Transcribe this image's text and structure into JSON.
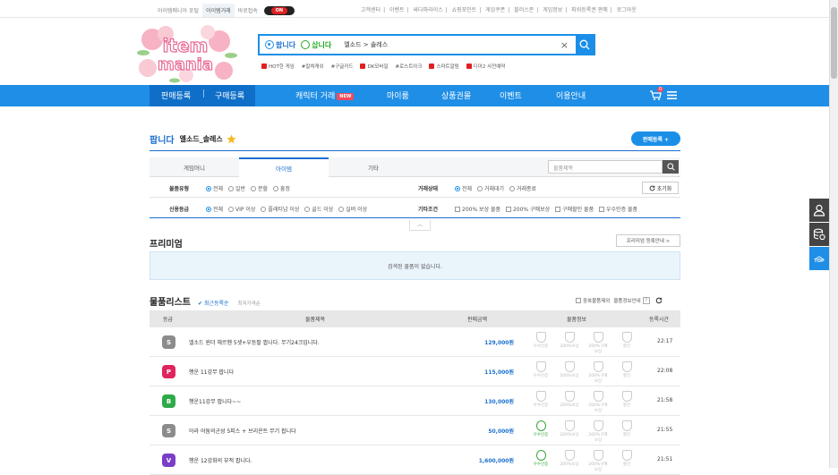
{
  "topbar": {
    "left": [
      "아이템매니아 포털",
      "아이템거래",
      "바로접속"
    ],
    "toggle": "ON",
    "right": [
      "고객센터",
      "이벤트",
      "싸다파라이스",
      "쇼핑포인트",
      "게임쿠폰",
      "블러스존",
      "게임정보",
      "파워등록권 판매",
      "로그아웃"
    ]
  },
  "logo": {
    "text1": "item",
    "text2": "mania"
  },
  "search": {
    "sell_label": "팝니다",
    "buy_label": "삽니다",
    "query": "엘소드 > 솔레스"
  },
  "hotlinks": [
    "HOT한 게임",
    "#칼쳐캐쉬",
    "#구글카드",
    "DK모바일",
    "#로스트아크",
    "스마트알림",
    "디아2 사전예약"
  ],
  "nav": {
    "sell_register": "판매등록",
    "sep": "|",
    "buy_register": "구매등록",
    "char_trade": "캐릭터 거래",
    "new_badge": "NEW",
    "mypage": "마이룸",
    "voucher": "상품권몰",
    "event": "이벤트",
    "guide": "이용안내",
    "cart_count": "0"
  },
  "crumb": {
    "title": "팝니다",
    "path": "엘소드_솔레스"
  },
  "register_button": "판매등록 +",
  "tabs": [
    "게임머니",
    "아이템",
    "기타"
  ],
  "product_search_placeholder": "물품제목",
  "filters": {
    "type_label": "물품유형",
    "type_opts": [
      "전체",
      "일반",
      "분할",
      "흥정"
    ],
    "state_label": "거래상태",
    "state_opts": [
      "전체",
      "거래대기",
      "거래종료"
    ],
    "reset": "초기화",
    "credit_label": "신용등급",
    "credit_opts": [
      "전체",
      "VIP 이상",
      "플래티넘 이상",
      "골드 이상",
      "실버 이상"
    ],
    "etc_label": "기타조건",
    "etc_opts": [
      "200% 보상 물품",
      "200% 구매보상",
      "구매할인 물품",
      "우수인증 물품"
    ]
  },
  "premium": {
    "title": "프리미엄",
    "guide": "프리미엄 등록안내 >",
    "empty": "검색된 물품이 없습니다."
  },
  "list": {
    "title": "물품리스트",
    "sort_active": "최근등록순",
    "sort_other": "최저가격순",
    "opt1": "중복물품제외",
    "opt2": "물품정보안내",
    "headers": [
      "등급",
      "물품제목",
      "판매금액",
      "물품정보",
      "등록시간"
    ]
  },
  "badge_labels": [
    "우수인증",
    "200%보상",
    "200%구매보상",
    "할인"
  ],
  "rows": [
    {
      "grade": "S",
      "color": "#8c8c8c",
      "title": "엘소드 윈더 헤르헨 5셋+우등팔 팝니다. 무기24크입니다.",
      "price": "129,000원",
      "time": "22:17",
      "certified": false
    },
    {
      "grade": "P",
      "color": "#e0245e",
      "title": "행운 11강무 팝니다",
      "price": "115,000원",
      "time": "22:08",
      "certified": false
    },
    {
      "grade": "B",
      "color": "#2faa4a",
      "title": "행운11강무 팝니다~~",
      "price": "130,000원",
      "time": "21:58",
      "certified": false
    },
    {
      "grade": "S",
      "color": "#8c8c8c",
      "title": "아라 어둠의군성 5피스 + 브리온트 무기 팝니다",
      "price": "50,000원",
      "time": "21:55",
      "certified": true
    },
    {
      "grade": "V",
      "color": "#7a3ec8",
      "title": "행운 12강화의 부적 팝니다.",
      "price": "1,600,000원",
      "time": "21:51",
      "certified": true
    }
  ]
}
